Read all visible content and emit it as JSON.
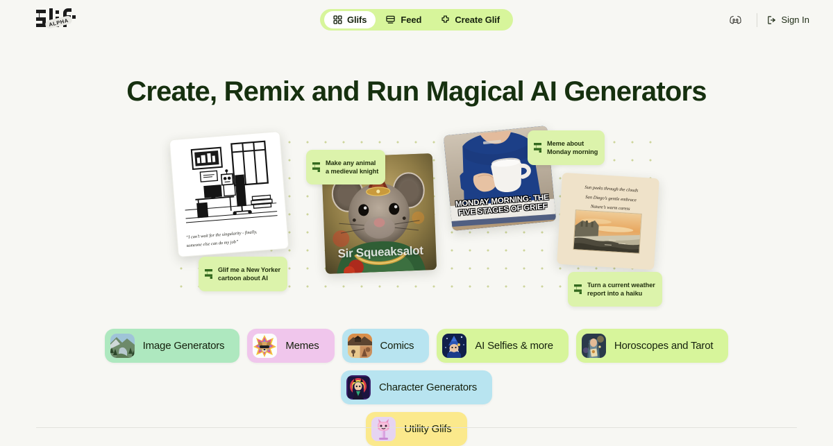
{
  "brand": {
    "logo_text": "glif",
    "badge": "ALPHA",
    "accent_green": "#d7f59b",
    "tag_green": "#dcf3ab",
    "headline_color": "#16300f",
    "page_bg": "#f7f7f3"
  },
  "nav": {
    "items": [
      {
        "label": "Glifs",
        "icon": "grid-icon",
        "active": true
      },
      {
        "label": "Feed",
        "icon": "feed-window-icon",
        "active": false
      },
      {
        "label": "Create Glif",
        "icon": "plus-cross-icon",
        "active": false
      }
    ]
  },
  "header_right": {
    "discord_icon": "discord-icon",
    "signin_label": "Sign In",
    "signin_icon": "login-arrow-icon"
  },
  "hero": {
    "headline": "Create, Remix and Run Magical AI Generators",
    "cards": [
      {
        "id": "cartoon",
        "type": "new-yorker-cartoon",
        "caption_line1": "“I can’t wait for the singularity - finally,",
        "caption_line2": "someone else can do my job”",
        "tag": "Glif me a New Yorker\ncartoon about AI"
      },
      {
        "id": "mouse-knight",
        "type": "ai-image",
        "title": "Sir Squeaksalot",
        "tag": "Make any animal\na medieval knight"
      },
      {
        "id": "monday-meme",
        "type": "meme",
        "meme_text": "MONDAY MORNING: THE FIVE\nSTAGES OF GRIEF",
        "tag": "Meme about\nMonday morning"
      },
      {
        "id": "haiku-postcard",
        "type": "postcard",
        "haiku_line1": "Sun peeks through the clouds",
        "haiku_line2": "San Diego’s gentle embrace",
        "haiku_line3": "Nature’s warm caress",
        "tag": "Turn a current weather\nreport into a haiku"
      }
    ]
  },
  "categories": [
    {
      "label": "Image Generators",
      "color": "#aee8bf",
      "thumb": "landscape-river-thumb"
    },
    {
      "label": "Memes",
      "color": "#f0c6ec",
      "thumb": "rainbow-dog-thumb"
    },
    {
      "label": "Comics",
      "color": "#b8e4f0",
      "thumb": "comic-panels-thumb"
    },
    {
      "label": "AI Selfies & more",
      "color": "#d7f59b",
      "thumb": "wizard-thumb"
    },
    {
      "label": "Horoscopes and Tarot",
      "color": "#d7f59b",
      "thumb": "tarot-woman-thumb"
    },
    {
      "label": "Character Generators",
      "color": "#b8e4f0",
      "thumb": "anime-character-thumb"
    },
    {
      "label": "Utility Glifs",
      "color": "#fbe98c",
      "thumb": "pink-robot-thumb"
    }
  ]
}
